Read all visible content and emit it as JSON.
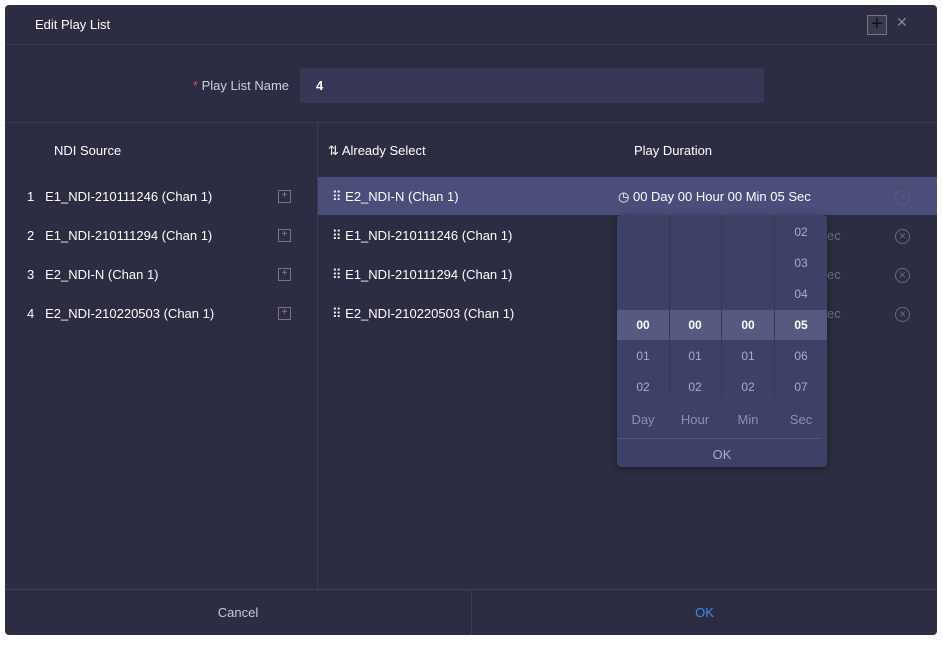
{
  "dialog": {
    "title": "Edit Play List"
  },
  "form": {
    "name_label": "Play List Name",
    "required_mark": "*",
    "name_value": "4"
  },
  "left": {
    "header": "NDI Source",
    "items": [
      {
        "index": "1",
        "name": "E1_NDI-210111246 (Chan 1)"
      },
      {
        "index": "2",
        "name": "E1_NDI-210111294 (Chan 1)"
      },
      {
        "index": "3",
        "name": "E2_NDI-N (Chan 1)"
      },
      {
        "index": "4",
        "name": "E2_NDI-210220503 (Chan 1)"
      }
    ]
  },
  "right": {
    "header_select": "Already Select",
    "header_duration": "Play Duration",
    "items": [
      {
        "name": "E2_NDI-N (Chan 1)",
        "duration": "00 Day 00 Hour 00 Min 05 Sec"
      },
      {
        "name": "E1_NDI-210111246 (Chan 1)",
        "duration": "ec"
      },
      {
        "name": "E1_NDI-210111294 (Chan 1)",
        "duration": "ec"
      },
      {
        "name": "E2_NDI-210220503 (Chan 1)",
        "duration": "ec"
      }
    ]
  },
  "picker": {
    "day": [
      "00",
      "01",
      "02"
    ],
    "hour": [
      "00",
      "01",
      "02"
    ],
    "min": [
      "00",
      "01",
      "02"
    ],
    "sec": [
      "02",
      "03",
      "04",
      "05",
      "06",
      "07"
    ],
    "units": [
      "Day",
      "Hour",
      "Min",
      "Sec"
    ],
    "ok": "OK"
  },
  "footer": {
    "cancel": "Cancel",
    "ok": "OK"
  },
  "colors": {
    "background": "#2c2d42",
    "selected_row": "#4b4e7a",
    "ok_accent": "#3a8ee6"
  }
}
